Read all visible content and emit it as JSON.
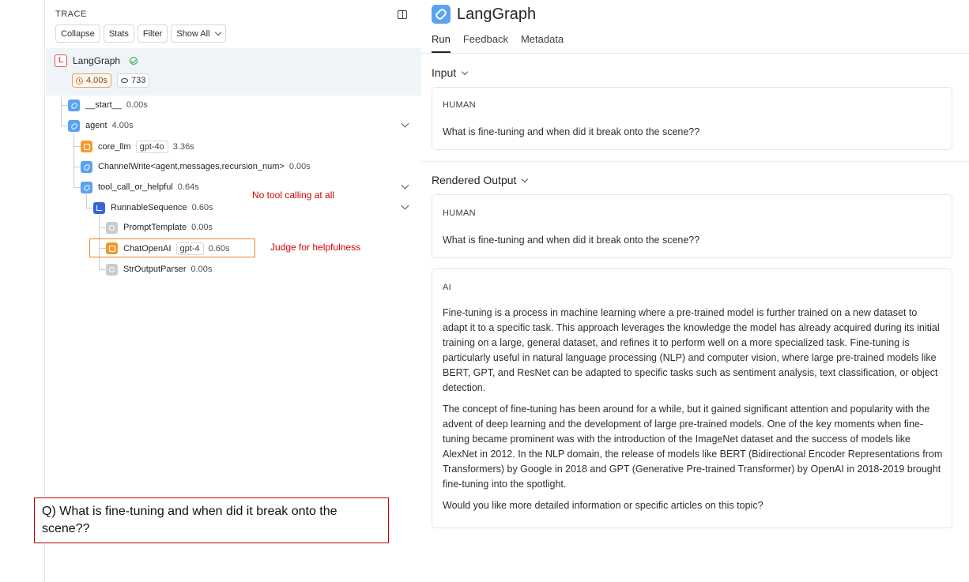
{
  "trace": {
    "label": "TRACE",
    "toolbar": {
      "collapse": "Collapse",
      "stats": "Stats",
      "filter": "Filter",
      "show_all": "Show All"
    },
    "root": {
      "name": "LangGraph",
      "duration": "4.00s",
      "tokens": "733"
    },
    "nodes": [
      {
        "name": "__start__",
        "duration": "0.00s"
      },
      {
        "name": "agent",
        "duration": "4.00s"
      },
      {
        "name": "core_llm",
        "tag": "gpt-4o",
        "duration": "3.36s"
      },
      {
        "name": "ChannelWrite<agent,messages,recursion_num>",
        "duration": "0.00s"
      },
      {
        "name": "tool_call_or_helpful",
        "duration": "0.64s"
      },
      {
        "name": "RunnableSequence",
        "duration": "0.60s"
      },
      {
        "name": "PromptTemplate",
        "duration": "0.00s"
      },
      {
        "name": "ChatOpenAI",
        "tag": "gpt-4",
        "duration": "0.60s"
      },
      {
        "name": "StrOutputParser",
        "duration": "0.00s"
      }
    ],
    "annotations": {
      "no_tool": "No tool calling at all",
      "judge": "Judge for helpfulness"
    },
    "question": "Q) What is fine-tuning and when did it break onto the scene??"
  },
  "detail": {
    "title": "LangGraph",
    "tabs": [
      "Run",
      "Feedback",
      "Metadata"
    ],
    "input": {
      "header": "Input",
      "role": "HUMAN",
      "message": "What is fine-tuning and when did it break onto the scene??"
    },
    "output": {
      "header": "Rendered Output",
      "human_role": "HUMAN",
      "human_message": "What is fine-tuning and when did it break onto the scene??",
      "ai_role": "AI",
      "ai_paragraphs": [
        "Fine-tuning is a process in machine learning where a pre-trained model is further trained on a new dataset to adapt it to a specific task. This approach leverages the knowledge the model has already acquired during its initial training on a large, general dataset, and refines it to perform well on a more specialized task. Fine-tuning is particularly useful in natural language processing (NLP) and computer vision, where large pre-trained models like BERT, GPT, and ResNet can be adapted to specific tasks such as sentiment analysis, text classification, or object detection.",
        "The concept of fine-tuning has been around for a while, but it gained significant attention and popularity with the advent of deep learning and the development of large pre-trained models. One of the key moments when fine-tuning became prominent was with the introduction of the ImageNet dataset and the success of models like AlexNet in 2012. In the NLP domain, the release of models like BERT (Bidirectional Encoder Representations from Transformers) by Google in 2018 and GPT (Generative Pre-trained Transformer) by OpenAI in 2018-2019 brought fine-tuning into the spotlight.",
        "Would you like more detailed information or specific articles on this topic?"
      ]
    }
  },
  "colors": {
    "chain_icon": "#5ba2f0",
    "llm_icon": "#f39a2c",
    "sequence_icon": "#3367d6",
    "annotation_red": "#d40000",
    "highlight_orange": "#e8862c"
  }
}
